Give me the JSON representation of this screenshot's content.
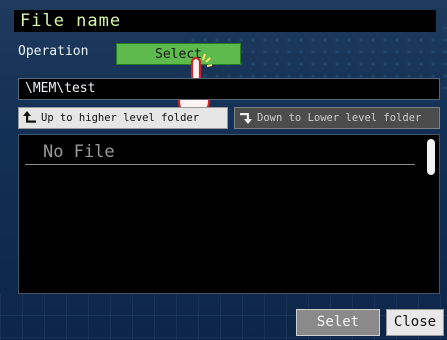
{
  "window": {
    "title": "File name"
  },
  "operation": {
    "label": "Operation",
    "selected_value": "Select"
  },
  "path": {
    "current": "\\MEM\\test"
  },
  "navigation": {
    "up_label": "Up to higher level folder",
    "down_label": "Down to Lower level folder"
  },
  "file_list": {
    "items": [
      "No File"
    ]
  },
  "footer": {
    "select_label": "Selet",
    "close_label": "Close"
  },
  "colors": {
    "title_text": "#d7f7a8",
    "operation_button": "#5dbb4e",
    "background": "#123055"
  },
  "icons": {
    "pointer": "hand-pointer-icon",
    "up": "arrow-up-corner-icon",
    "down": "arrow-down-corner-icon"
  }
}
